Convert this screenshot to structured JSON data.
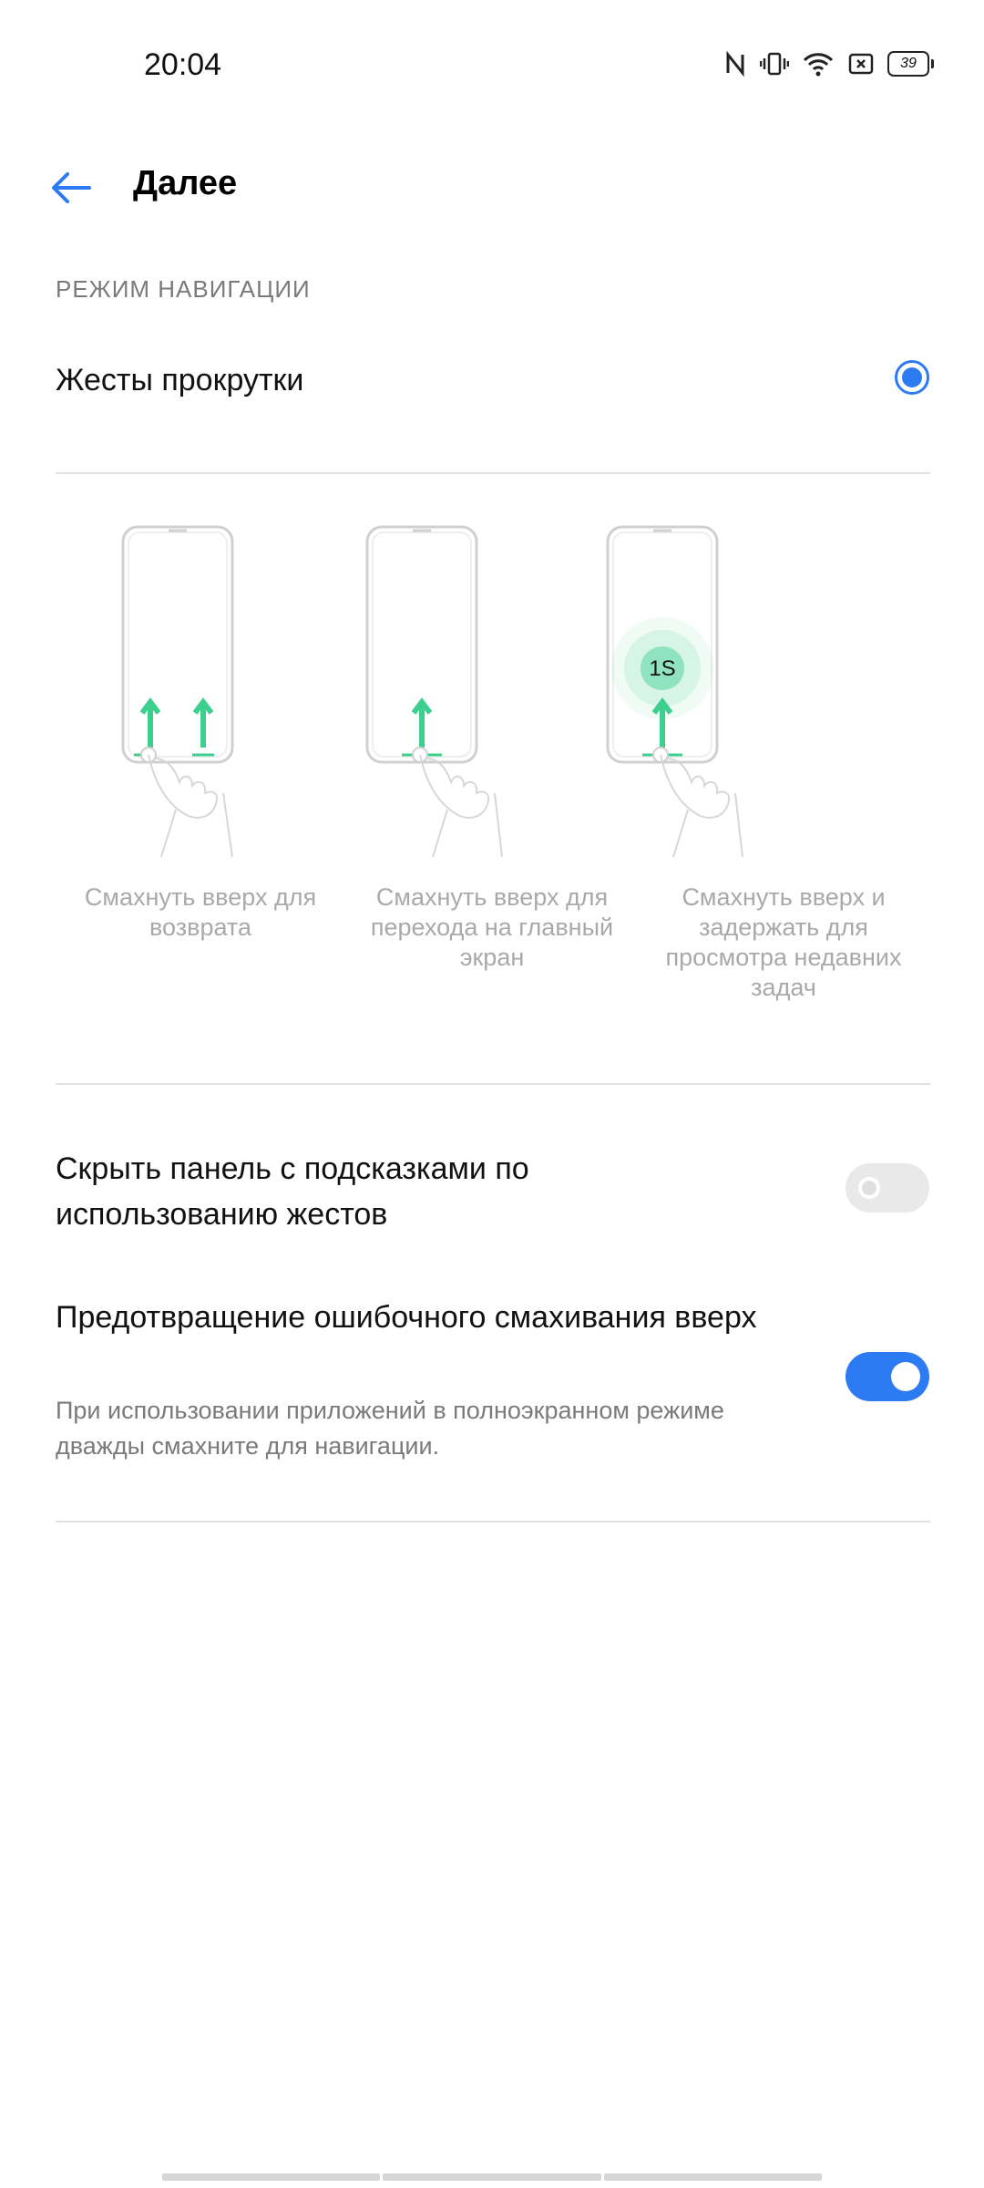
{
  "status_bar": {
    "time": "20:04",
    "battery": "39",
    "icons": [
      "nfc-icon",
      "vibrate-icon",
      "wifi-icon",
      "sim-icon",
      "battery-icon"
    ]
  },
  "header": {
    "title": "Далее",
    "back_icon": "arrow-left-icon"
  },
  "section": {
    "label": "РЕЖИМ НАВИГАЦИИ"
  },
  "navigation_option": {
    "label": "Жесты прокрутки",
    "selected": true
  },
  "illustrations": [
    {
      "caption": "Смахнуть вверх для возврата"
    },
    {
      "caption": "Смахнуть вверх для перехода на главный экран"
    },
    {
      "caption": "Смахнуть вверх и задержать для просмотра недавних задач",
      "badge": "1S"
    }
  ],
  "settings": {
    "hide_hint_bar": {
      "title": "Скрыть панель с подсказками по использованию жестов",
      "enabled": false
    },
    "prevent_mis_swipe": {
      "title": "Предотвращение ошибочного смахивания вверх",
      "subtitle": "При использовании приложений в полноэкранном режиме дважды смахните для навигации.",
      "enabled": true
    }
  },
  "colors": {
    "accent": "#2d7bf3",
    "gesture_green": "#3ccf8e",
    "divider": "#e1e1e1"
  }
}
